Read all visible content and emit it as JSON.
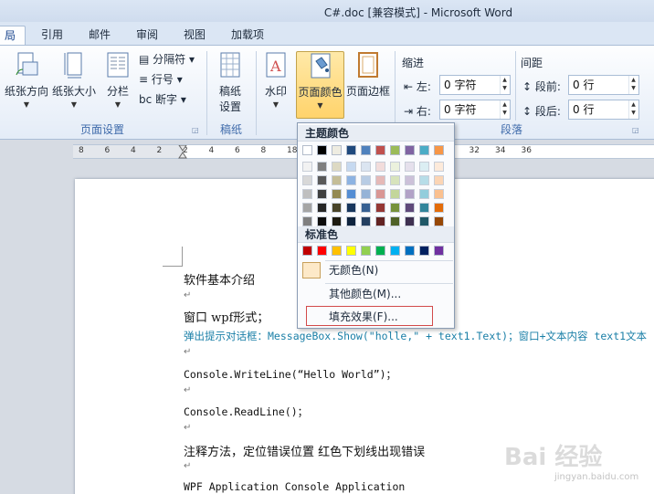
{
  "window": {
    "title": "C#.doc [兼容模式]  -  Microsoft Word"
  },
  "tabs": [
    {
      "label": "布局",
      "visible_label": "局",
      "active": true
    },
    {
      "label": "引用"
    },
    {
      "label": "邮件"
    },
    {
      "label": "审阅"
    },
    {
      "label": "视图"
    },
    {
      "label": "加载项"
    }
  ],
  "ribbon": {
    "page_setup": {
      "orientation": "纸张方向",
      "size": "纸张大小",
      "columns": "分栏",
      "breaks": "分隔符",
      "line_numbers": "行号",
      "hyphenation": "断字",
      "group_label": "页面设置"
    },
    "manuscript": {
      "btn_line1": "稿纸",
      "btn_line2": "设置",
      "group_label": "稿纸"
    },
    "page_background": {
      "watermark": "水印",
      "page_color": "页面颜色",
      "page_borders": "页面边框"
    },
    "paragraph": {
      "indent_title": "缩进",
      "left_label": "左:",
      "left_value": "0 字符",
      "right_label": "右:",
      "right_value": "0 字符",
      "spacing_title": "间距",
      "before_label": "段前:",
      "before_value": "0 行",
      "after_label": "段后:",
      "after_value": "0 行",
      "group_label": "段落"
    }
  },
  "ruler": {
    "numbers": [
      "8",
      "6",
      "4",
      "2",
      "2",
      "4",
      "6",
      "8",
      "18",
      "20",
      "22",
      "24",
      "26",
      "28",
      "30",
      "32",
      "34",
      "36"
    ]
  },
  "color_menu": {
    "theme_header": "主题颜色",
    "standard_header": "标准色",
    "no_color": "无颜色(N)",
    "more_colors": "其他颜色(M)...",
    "fill_effects": "填充效果(F)...",
    "theme_top_row": [
      "#ffffff",
      "#000000",
      "#eeece1",
      "#1f497d",
      "#4f81bd",
      "#c0504d",
      "#9bbb59",
      "#8064a2",
      "#4bacc6",
      "#f79646"
    ],
    "theme_columns": [
      [
        "#f2f2f2",
        "#d8d8d8",
        "#bfbfbf",
        "#a5a5a5",
        "#7f7f7f"
      ],
      [
        "#7f7f7f",
        "#595959",
        "#3f3f3f",
        "#262626",
        "#0c0c0c"
      ],
      [
        "#ddd9c3",
        "#c4bd97",
        "#938953",
        "#494429",
        "#1d1b10"
      ],
      [
        "#c6d9f0",
        "#8db3e2",
        "#548dd4",
        "#17365d",
        "#0f243e"
      ],
      [
        "#dbe5f1",
        "#b8cce4",
        "#95b3d7",
        "#366092",
        "#244061"
      ],
      [
        "#f2dcdb",
        "#e5b9b7",
        "#d99694",
        "#953734",
        "#632423"
      ],
      [
        "#ebf1dd",
        "#d7e3bc",
        "#c3d69b",
        "#76923c",
        "#4f6128"
      ],
      [
        "#e5e0ec",
        "#ccc1d9",
        "#b2a2c7",
        "#5f497a",
        "#3f3151"
      ],
      [
        "#dbeef3",
        "#b7dde8",
        "#92cddc",
        "#31859b",
        "#205867"
      ],
      [
        "#fdeada",
        "#fbd5b5",
        "#fac08f",
        "#e36c09",
        "#974806"
      ]
    ],
    "standard_colors": [
      "#c00000",
      "#ff0000",
      "#ffc000",
      "#ffff00",
      "#92d050",
      "#00b050",
      "#00b0f0",
      "#0070c0",
      "#002060",
      "#7030a0"
    ]
  },
  "document": {
    "lines": [
      {
        "text": "软件基本介绍"
      },
      {
        "text": "窗口  wpf形式；"
      },
      {
        "text": "弹出提示对话框：MessageBox.Show(\"holle,\" + text1.Text)；窗口+文本内容    text1文本"
      },
      {
        "text": "Console.WriteLine(“Hello World”)；"
      },
      {
        "text": "Console.ReadLine()；"
      },
      {
        "text": "注释方法，定位错误位置  红色下划线出现错误"
      },
      {
        "text": "WPF Application   Console Application"
      }
    ],
    "para_mark": "↵"
  },
  "watermark": {
    "main": "Bai 经验",
    "sub": "jingyan.baidu.com"
  }
}
